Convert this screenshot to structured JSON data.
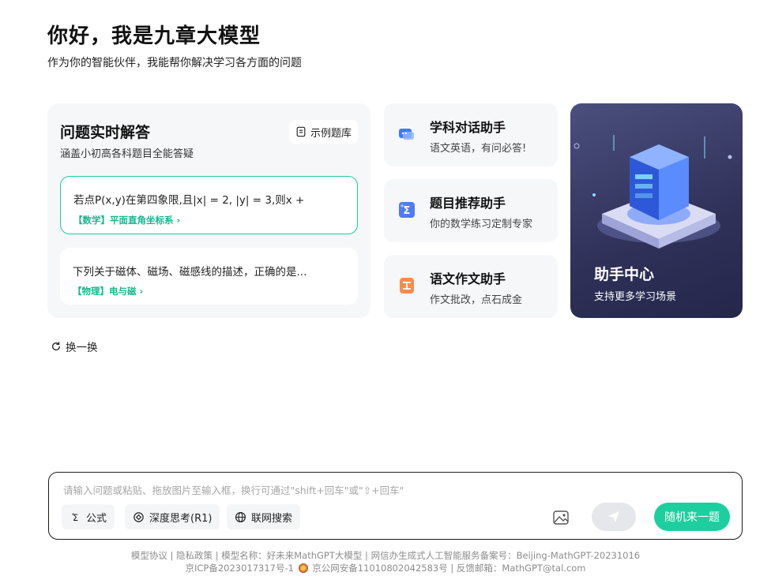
{
  "header": {
    "greeting": "你好，我是九章大模型",
    "subtitle": "作为你的智能伙伴，我能帮你解决学习各方面的问题"
  },
  "qa_card": {
    "title": "问题实时解答",
    "description": "涵盖小初高各科题目全能答疑",
    "bank_label": "示例题库",
    "questions": [
      {
        "text": "若点P(x,y)在第四象限,且|x| = 2, |y| = 3,则x +",
        "tag": "【数学】平面直角坐标系 ›"
      },
      {
        "text": "下列关于磁体、磁场、磁感线的描述，正确的是...",
        "tag": "【物理】电与磁 ›"
      }
    ]
  },
  "assistants": [
    {
      "title": "学科对话助手",
      "desc": "语文英语，有问必答!",
      "icon": "chat-icon"
    },
    {
      "title": "题目推荐助手",
      "desc": "你的数学练习定制专家",
      "icon": "sigma-icon"
    },
    {
      "title": "语文作文助手",
      "desc": "作文批改，点石成金",
      "icon": "essay-icon"
    }
  ],
  "hub": {
    "title": "助手中心",
    "desc": "支持更多学习场景"
  },
  "refresh_label": "换一换",
  "input": {
    "placeholder": "请输入问题或粘贴、拖放图片至输入框，换行可通过\"shift+回车\"或\"⇧+回车\"",
    "value": "",
    "tools": [
      "公式",
      "深度思考(R1)",
      "联网搜索"
    ],
    "random_label": "随机来一题"
  },
  "footer": {
    "line1": "模型协议 | 隐私政策 | 模型名称：好未来MathGPT大模型 | 网信办生成式人工智能服务备案号：Beijing-MathGPT-20231016",
    "line2a": "京ICP备2023017317号-1",
    "line2b": "京公网安备11010802042583号 | 反馈邮箱：MathGPT@tal.com"
  },
  "colors": {
    "accent": "#1dcf9e",
    "tag_green": "#13b98c",
    "card_bg": "#f6f7f9",
    "hub_bg": "#2f3159"
  }
}
